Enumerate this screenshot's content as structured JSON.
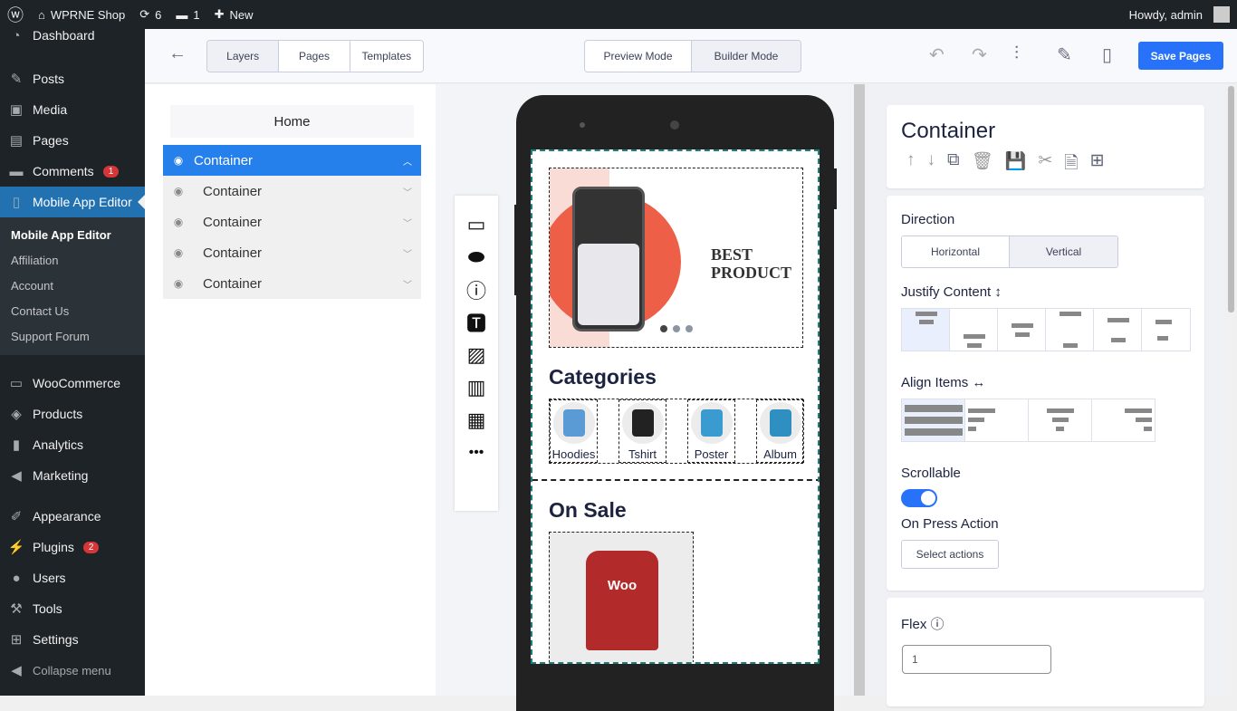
{
  "adminbar": {
    "site": "WPRNE Shop",
    "updates": "6",
    "comments": "1",
    "new": "New",
    "howdy": "Howdy, admin"
  },
  "sidebar": {
    "items": [
      {
        "label": "Dashboard",
        "icon": "dashboard-icon",
        "glyph": "◔"
      },
      {
        "label": "Posts",
        "icon": "pin-icon",
        "glyph": "✎"
      },
      {
        "label": "Media",
        "icon": "media-icon",
        "glyph": "▣"
      },
      {
        "label": "Pages",
        "icon": "pages-icon",
        "glyph": "▤"
      },
      {
        "label": "Comments",
        "icon": "comment-icon",
        "glyph": "▬",
        "badge": "1"
      },
      {
        "label": "Mobile App Editor",
        "icon": "mobile-icon",
        "glyph": "▯"
      },
      {
        "label": "WooCommerce",
        "icon": "woo-icon",
        "glyph": "▭"
      },
      {
        "label": "Products",
        "icon": "box-icon",
        "glyph": "◈"
      },
      {
        "label": "Analytics",
        "icon": "chart-icon",
        "glyph": "▮"
      },
      {
        "label": "Marketing",
        "icon": "megaphone-icon",
        "glyph": "◀"
      },
      {
        "label": "Appearance",
        "icon": "brush-icon",
        "glyph": "✐"
      },
      {
        "label": "Plugins",
        "icon": "plugin-icon",
        "glyph": "⚡",
        "badge": "2"
      },
      {
        "label": "Users",
        "icon": "user-icon",
        "glyph": "●"
      },
      {
        "label": "Tools",
        "icon": "wrench-icon",
        "glyph": "⚒"
      },
      {
        "label": "Settings",
        "icon": "settings-icon",
        "glyph": "⊞"
      },
      {
        "label": "Collapse menu",
        "icon": "collapse-icon",
        "glyph": "◀"
      }
    ],
    "submenu": [
      "Mobile App Editor",
      "Affiliation",
      "Account",
      "Contact Us",
      "Support Forum"
    ]
  },
  "header": {
    "tabs": [
      "Layers",
      "Pages",
      "Templates"
    ],
    "modes": [
      "Preview Mode",
      "Builder Mode"
    ],
    "save": "Save Pages"
  },
  "layers": {
    "page": "Home",
    "items": [
      "Container",
      "Container",
      "Container",
      "Container",
      "Container"
    ]
  },
  "preview": {
    "banner": "BEST PRODUCT",
    "categories_title": "Categories",
    "categories": [
      "Hoodies",
      "Tshirt",
      "Poster",
      "Album"
    ],
    "sale_title": "On Sale",
    "product_logo": "Woo"
  },
  "inspector": {
    "title": "Container",
    "direction_label": "Direction",
    "direction_options": [
      "Horizontal",
      "Vertical"
    ],
    "direction_selected": "Vertical",
    "justify_label": "Justify Content",
    "align_label": "Align Items",
    "scrollable_label": "Scrollable",
    "scrollable": true,
    "press_label": "On Press Action",
    "press_button": "Select actions",
    "flex_label": "Flex",
    "flex_value": "1"
  }
}
